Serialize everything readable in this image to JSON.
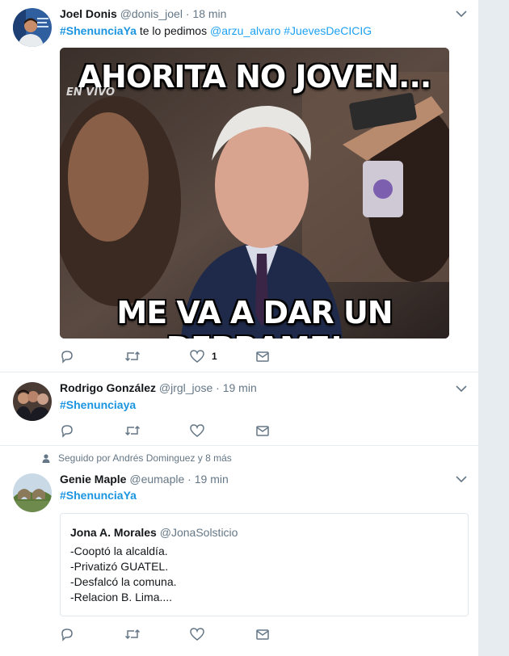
{
  "tweets": [
    {
      "name": "Joel Donis",
      "handle": "@donis_joel",
      "time": "18 min",
      "hashtag": "#ShenunciaYa",
      "text": "te lo pedimos",
      "mention": "@arzu_alvaro",
      "hashtag2": "#JuevesDeCICIG",
      "meme_top": "AHORITA NO JOVEN...",
      "meme_bottom": "ME VA A DAR UN DERRAME!",
      "meme_watermark": "EN VIVO",
      "likes": "1"
    },
    {
      "name": "Rodrigo González",
      "handle": "@jrgl_jose",
      "time": "19 min",
      "hashtag": "#Shenunciaya"
    },
    {
      "social_context": "Seguido por Andrés Dominguez y 8 más",
      "name": "Genie Maple",
      "handle": "@eumaple",
      "time": "19 min",
      "hashtag": "#ShenunciaYa",
      "quoted": {
        "name": "Jona A. Morales",
        "handle": "@JonaSolsticio",
        "lines": [
          "-Cooptó la alcaldía.",
          "-Privatizó GUATEL.",
          "-Desfalcó la comuna.",
          "-Relacion B. Lima...."
        ]
      }
    }
  ],
  "separator": "·",
  "icons": {
    "reply": "reply-icon",
    "retweet": "retweet-icon",
    "like": "heart-icon",
    "dm": "envelope-icon",
    "caret": "chevron-down-icon",
    "social": "person-icon"
  },
  "colors": {
    "link": "#1da1f2",
    "muted": "#657786",
    "background": "#e6ecf0"
  }
}
